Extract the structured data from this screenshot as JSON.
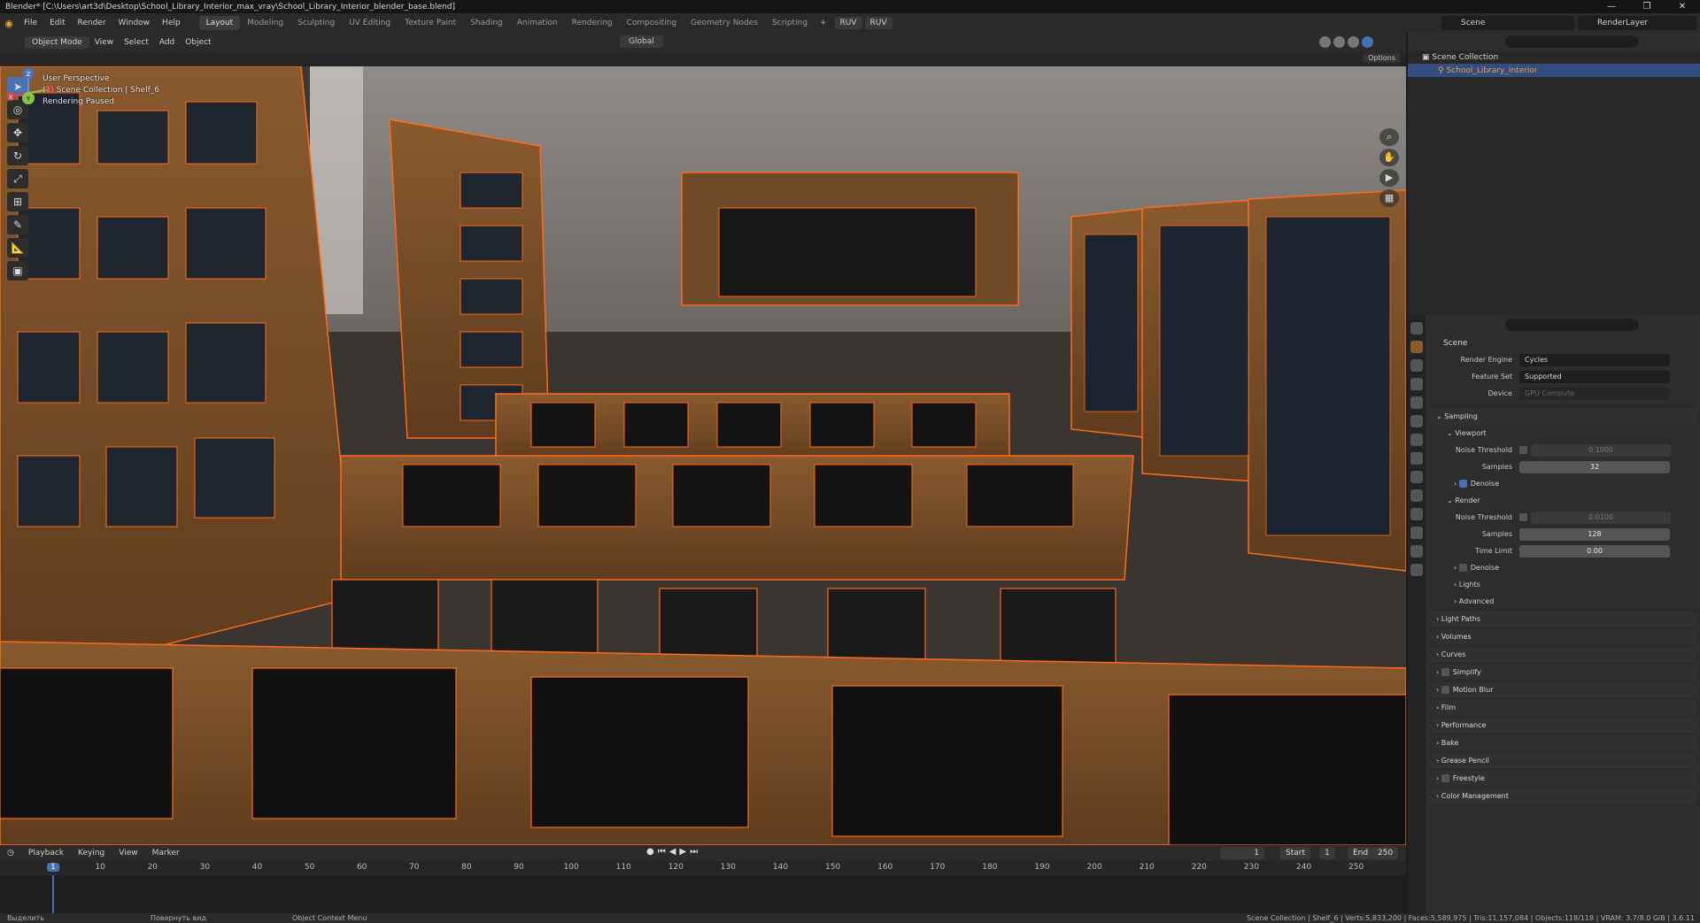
{
  "window": {
    "title": "Blender* [C:\\Users\\art3d\\Desktop\\School_Library_Interior_max_vray\\School_Library_Interior_blender_base.blend]",
    "controls": [
      "—",
      "❐",
      "✕"
    ]
  },
  "menubar": {
    "menus": [
      "File",
      "Edit",
      "Render",
      "Window",
      "Help"
    ],
    "workspaces": [
      "Layout",
      "Modeling",
      "Sculpting",
      "UV Editing",
      "Texture Paint",
      "Shading",
      "Animation",
      "Rendering",
      "Compositing",
      "Geometry Nodes",
      "Scripting"
    ],
    "active_workspace": "Layout",
    "add_tab": "+",
    "ruv1": "RUV",
    "ruv2": "RUV",
    "scene": "Scene",
    "view_layer": "RenderLayer"
  },
  "viewport_header": {
    "mode": "Object Mode",
    "menus": [
      "View",
      "Select",
      "Add",
      "Object"
    ],
    "transform": "Global",
    "options": "Options"
  },
  "viewport": {
    "info_line1": "User Perspective",
    "info_line2": "(1) Scene Collection | Shelf_6",
    "info_line3": "Rendering Paused"
  },
  "gizmo": {
    "x": "X",
    "y": "Y",
    "z": "Z"
  },
  "timeline": {
    "menus": [
      "Playback",
      "Keying",
      "View",
      "Marker"
    ],
    "current_frame": "1",
    "start_label": "Start",
    "start": "1",
    "end_label": "End",
    "end": "250",
    "ticks": [
      "1",
      "10",
      "20",
      "30",
      "40",
      "50",
      "60",
      "70",
      "80",
      "90",
      "100",
      "110",
      "120",
      "130",
      "140",
      "150",
      "160",
      "170",
      "180",
      "190",
      "200",
      "210",
      "220",
      "230",
      "240",
      "250"
    ]
  },
  "statusbar": {
    "left": "Выделить",
    "mid1": "Повернуть вид",
    "mid2": "Object Context Menu",
    "right": "Scene Collection | Shelf_6 | Verts:5,833,200 | Faces:5,589,975 | Tris:11,157,084 | Objects:118/118 | VRAM: 3.7/8.0 GiB | 3.6.11"
  },
  "outliner": {
    "root": "Scene Collection",
    "item": "School_Library_Interior"
  },
  "properties": {
    "crumb": "Scene",
    "render_engine_label": "Render Engine",
    "render_engine": "Cycles",
    "feature_set_label": "Feature Set",
    "feature_set": "Supported",
    "device_label": "Device",
    "device": "GPU Compute",
    "sampling": "Sampling",
    "viewport": "Viewport",
    "noise_threshold_label": "Noise Threshold",
    "vp_noise": "0.1000",
    "samples_label": "Samples",
    "vp_samples": "32",
    "denoise": "Denoise",
    "render": "Render",
    "r_noise": "0.0100",
    "r_samples": "128",
    "time_limit_label": "Time Limit",
    "time_limit": "0.00",
    "r_denoise": "Denoise",
    "lights": "Lights",
    "advanced": "Advanced",
    "panels": [
      "Light Paths",
      "Volumes",
      "Curves",
      "Simplify",
      "Motion Blur",
      "Film",
      "Performance",
      "Bake",
      "Grease Pencil",
      "Freestyle",
      "Color Management"
    ]
  }
}
